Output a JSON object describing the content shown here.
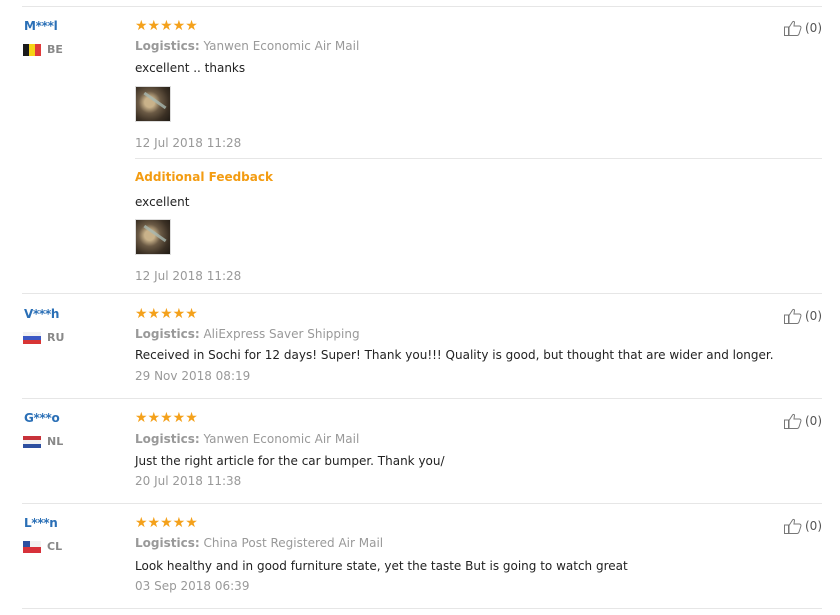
{
  "reviews": [
    {
      "user": "M***l",
      "country": "BE",
      "stars": "★★★★★",
      "logistics_label": "Logistics:",
      "logistics": "Yanwen Economic Air Mail",
      "text": "excellent .. thanks",
      "date": "12 Jul 2018 11:28",
      "likes": "(0)",
      "additional": {
        "title": "Additional Feedback",
        "text": "excellent",
        "date": "12 Jul 2018 11:28"
      }
    },
    {
      "user": "V***h",
      "country": "RU",
      "stars": "★★★★★",
      "logistics_label": "Logistics:",
      "logistics": "AliExpress Saver Shipping",
      "text": "Received in Sochi for 12 days! Super! Thank you!!! Quality is good, but thought that are wider and longer.",
      "date": "29 Nov 2018 08:19",
      "likes": "(0)"
    },
    {
      "user": "G***o",
      "country": "NL",
      "stars": "★★★★★",
      "logistics_label": "Logistics:",
      "logistics": "Yanwen Economic Air Mail",
      "text": "Just the right article for the car bumper. Thank you/",
      "date": "20 Jul 2018 11:38",
      "likes": "(0)"
    },
    {
      "user": "L***n",
      "country": "CL",
      "stars": "★★★★★",
      "logistics_label": "Logistics:",
      "logistics": "China Post Registered Air Mail",
      "text": "Look healthy and in good furniture state, yet the taste But is going to watch great",
      "date": "03 Sep 2018 06:39",
      "likes": "(0)"
    }
  ]
}
